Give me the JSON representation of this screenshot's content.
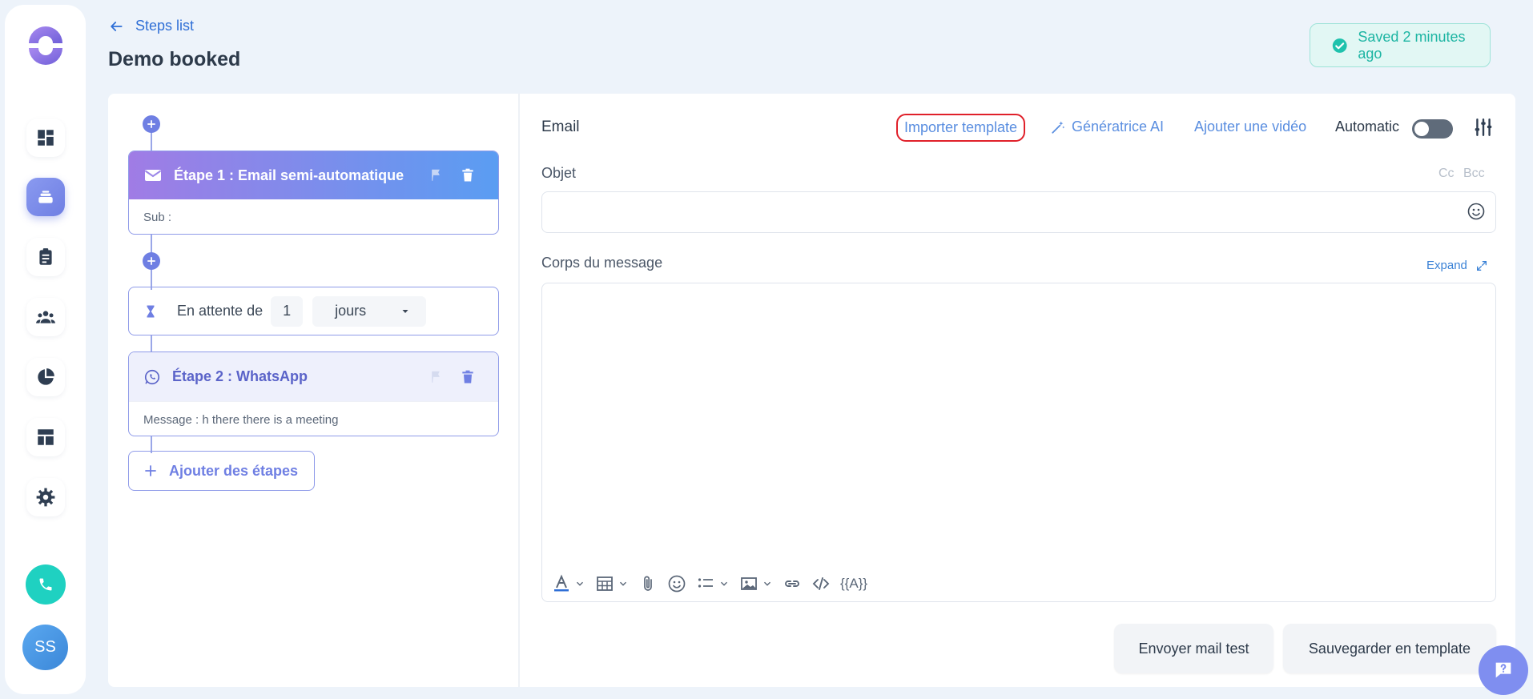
{
  "header": {
    "back_label": "Steps list",
    "title": "Demo booked",
    "saved_text": "Saved 2 minutes ago"
  },
  "sidebar": {
    "avatar_initials": "SS",
    "items": [
      {
        "icon": "dashboard-icon"
      },
      {
        "icon": "sequences-icon",
        "active": true
      },
      {
        "icon": "clipboard-icon"
      },
      {
        "icon": "team-icon"
      },
      {
        "icon": "pie-chart-icon"
      },
      {
        "icon": "layout-icon"
      },
      {
        "icon": "gear-icon"
      }
    ]
  },
  "steps": {
    "step1": {
      "title": "Étape 1 : Email semi-automatique",
      "body": "Sub :"
    },
    "wait": {
      "label": "En attente de",
      "value": "1",
      "unit": "jours"
    },
    "step2": {
      "title": "Étape 2 : WhatsApp",
      "body": "Message : h there there is a meeting"
    },
    "add_label": "Ajouter des étapes"
  },
  "editor": {
    "channel": "Email",
    "import_template": "Importer template",
    "ai_generator": "Génératrice AI",
    "add_video": "Ajouter une vidéo",
    "automatic_label": "Automatic",
    "automatic_on": false,
    "subject_label": "Objet",
    "cc": "Cc",
    "bcc": "Bcc",
    "subject_value": "",
    "body_label": "Corps du message",
    "expand": "Expand",
    "variables": "{{A}}",
    "send_test": "Envoyer mail test",
    "save_template": "Sauvegarder en template"
  },
  "colors": {
    "accent": "#6f7fe3",
    "link": "#5a8ee0",
    "saved": "#1db5a3",
    "highlight_border": "#e0202a"
  }
}
